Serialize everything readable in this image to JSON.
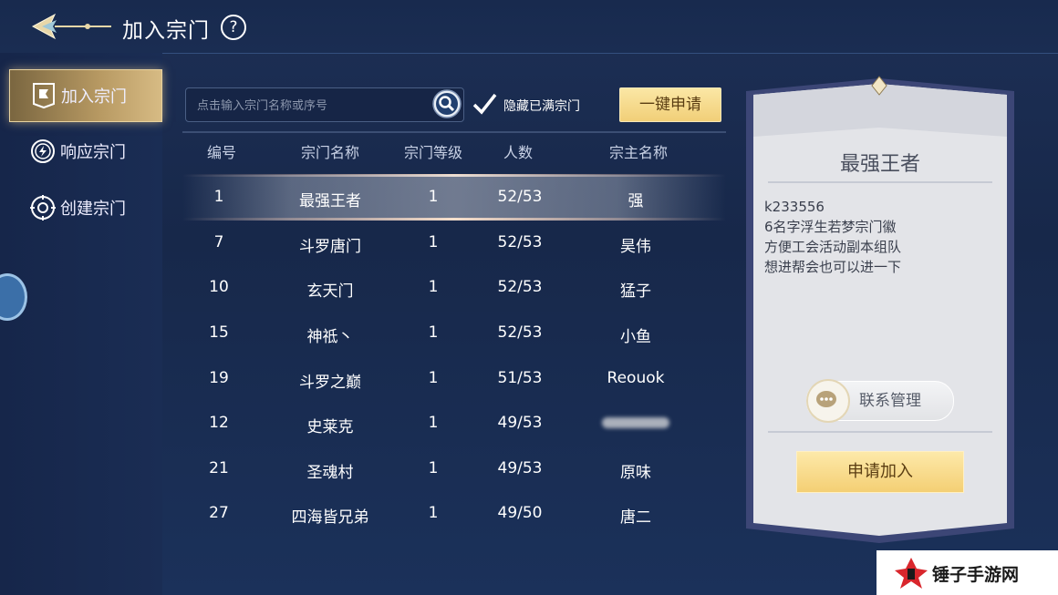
{
  "header": {
    "title": "加入宗门",
    "help_symbol": "?"
  },
  "sidebar": {
    "items": [
      {
        "label": "加入宗门",
        "active": true
      },
      {
        "label": "响应宗门",
        "active": false
      },
      {
        "label": "创建宗门",
        "active": false
      }
    ]
  },
  "search": {
    "placeholder": "点击输入宗门名称或序号",
    "value": ""
  },
  "filter": {
    "hide_full_label": "隐藏已满宗门",
    "checked": true
  },
  "toolbar": {
    "one_key_apply": "一键申请"
  },
  "table": {
    "columns": [
      "编号",
      "宗门名称",
      "宗门等级",
      "人数",
      "宗主名称"
    ],
    "rows": [
      {
        "id": "1",
        "name": "最强王者",
        "level": "1",
        "members": "52/53",
        "master": "强",
        "selected": true
      },
      {
        "id": "7",
        "name": "斗罗唐门",
        "level": "1",
        "members": "52/53",
        "master": "昊伟"
      },
      {
        "id": "10",
        "name": "玄天门",
        "level": "1",
        "members": "52/53",
        "master": "猛子"
      },
      {
        "id": "15",
        "name": "神祗丶",
        "level": "1",
        "members": "52/53",
        "master": "小鱼"
      },
      {
        "id": "19",
        "name": "斗罗之巅",
        "level": "1",
        "members": "51/53",
        "master": "Reouok"
      },
      {
        "id": "12",
        "name": "史莱克",
        "level": "1",
        "members": "49/53",
        "master": "",
        "master_obscured": true
      },
      {
        "id": "21",
        "name": "圣魂村",
        "level": "1",
        "members": "49/53",
        "master": "原味"
      },
      {
        "id": "27",
        "name": "四海皆兄弟",
        "level": "1",
        "members": "49/50",
        "master": "唐二"
      }
    ]
  },
  "detail": {
    "name": "最强王者",
    "description": "k233556\n6名字浮生若梦宗门徽\n方便工会活动副本组队\n想进帮会也可以进一下",
    "contact_button": "联系管理",
    "apply_button": "申请加入"
  },
  "watermark": {
    "text": "锤子手游网"
  },
  "colors": {
    "accent_gold": "#f4cf74",
    "panel_bg": "#1b2e54",
    "card_bg": "#e4e5e8"
  }
}
